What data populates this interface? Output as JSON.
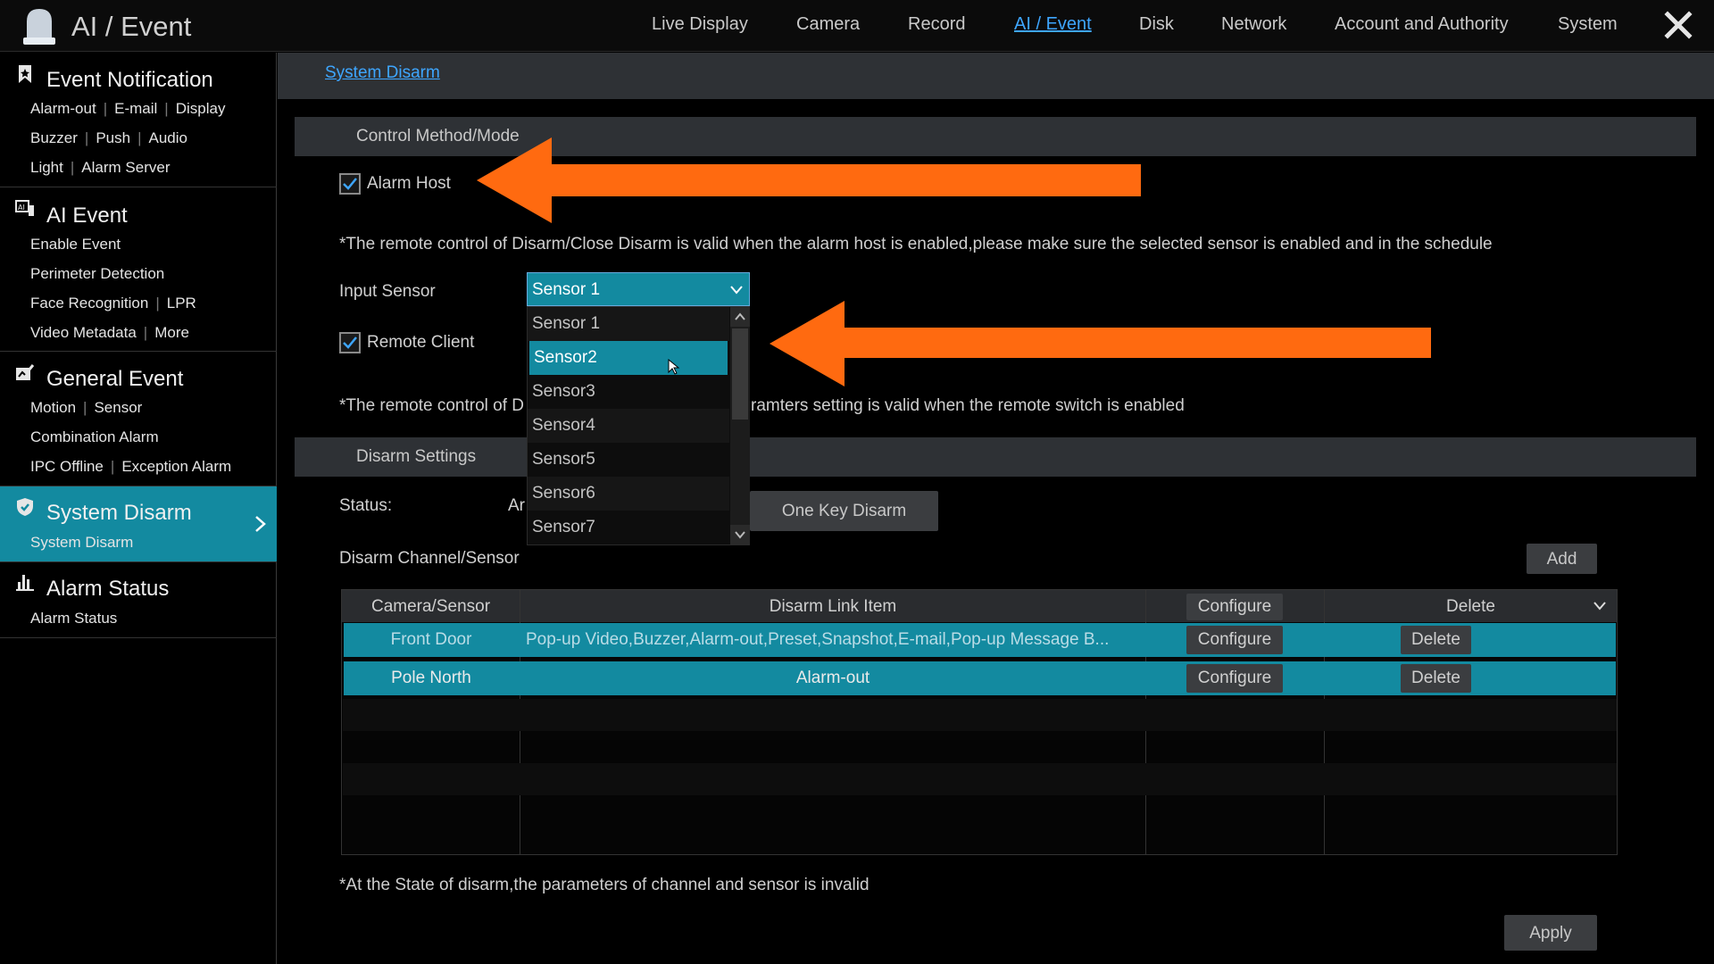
{
  "app": {
    "title": "AI / Event"
  },
  "nav": [
    {
      "label": "Live Display",
      "active": false
    },
    {
      "label": "Camera",
      "active": false
    },
    {
      "label": "Record",
      "active": false
    },
    {
      "label": "AI / Event",
      "active": true
    },
    {
      "label": "Disk",
      "active": false
    },
    {
      "label": "Network",
      "active": false
    },
    {
      "label": "Account and Authority",
      "active": false
    },
    {
      "label": "System",
      "active": false
    }
  ],
  "sidebar": {
    "event_notification": {
      "title": "Event Notification",
      "rows": [
        [
          "Alarm-out",
          "E-mail",
          "Display"
        ],
        [
          "Buzzer",
          "Push",
          "Audio"
        ],
        [
          "Light",
          "Alarm Server"
        ]
      ]
    },
    "ai_event": {
      "title": "AI Event",
      "rows": [
        [
          "Enable Event"
        ],
        [
          "Perimeter Detection"
        ],
        [
          "Face Recognition",
          "LPR"
        ],
        [
          "Video Metadata",
          "More"
        ]
      ]
    },
    "general_event": {
      "title": "General Event",
      "rows": [
        [
          "Motion",
          "Sensor"
        ],
        [
          "Combination Alarm"
        ],
        [
          "IPC Offline",
          "Exception Alarm"
        ]
      ]
    },
    "system_disarm": {
      "title": "System Disarm",
      "rows": [
        [
          "System Disarm"
        ]
      ]
    },
    "alarm_status": {
      "title": "Alarm Status",
      "rows": [
        [
          "Alarm Status"
        ]
      ]
    }
  },
  "breadcrumb": "System Disarm",
  "control": {
    "header": "Control Method/Mode",
    "alarm_host_label": "Alarm Host",
    "alarm_host_checked": true,
    "note1": "*The remote control of Disarm/Close Disarm is valid when the alarm host is enabled,please make sure the selected sensor is enabled and in the schedule",
    "input_sensor_label": "Input Sensor",
    "input_sensor_value": "Sensor 1",
    "sensor_options": [
      "Sensor 1",
      "Sensor2",
      "Sensor3",
      "Sensor4",
      "Sensor5",
      "Sensor6",
      "Sensor7"
    ],
    "sensor_hover": "Sensor2",
    "remote_client_label": "Remote Client",
    "remote_client_checked": true,
    "note2_left": "*The remote control of D",
    "note2_right": "ramters setting is valid when the remote switch is enabled"
  },
  "disarm": {
    "header": "Disarm Settings",
    "status_label": "Status:",
    "status_value": "Ar",
    "one_key_button": "One Key Disarm",
    "channel_label": "Disarm Channel/Sensor",
    "add_button": "Add",
    "columns": [
      "Camera/Sensor",
      "Disarm Link Item",
      "Configure",
      "Delete"
    ],
    "rows": [
      {
        "camera": "Front Door",
        "link": "Pop-up Video,Buzzer,Alarm-out,Preset,Snapshot,E-mail,Pop-up Message B...",
        "configure": "Configure",
        "delete": "Delete"
      },
      {
        "camera": "Pole North",
        "link": "Alarm-out",
        "configure": "Configure",
        "delete": "Delete"
      }
    ],
    "footnote": "*At the State of disarm,the parameters of channel and sensor is invalid",
    "apply_button": "Apply"
  },
  "colors": {
    "accent": "#138aa0",
    "link": "#3ea6ff",
    "annotation_arrow": "#ff6a10",
    "header_bar": "#2e3135"
  },
  "icons": [
    "alarm-bell-icon",
    "close-icon",
    "bookmark-icon",
    "ai-event-icon",
    "general-event-icon",
    "shield-icon",
    "bar-chart-icon",
    "chevron-right-icon",
    "chevron-down-icon",
    "checkmark-icon",
    "cursor-icon"
  ]
}
